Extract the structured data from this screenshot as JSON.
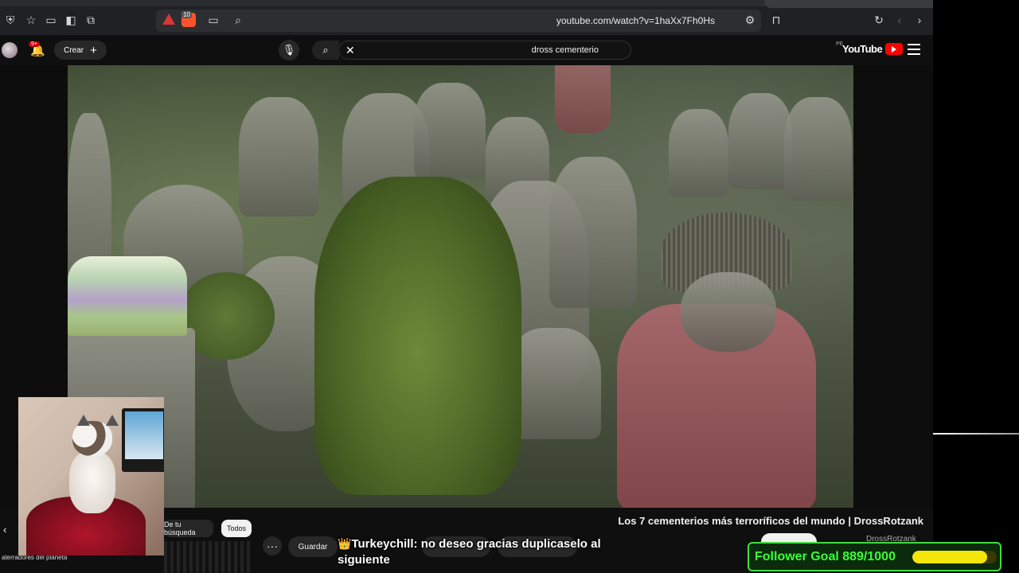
{
  "browser": {
    "url": "youtube.com/watch?v=1haXx7Fh0Hs",
    "brave_badge": "10"
  },
  "youtube": {
    "logo_text": "YouTube",
    "country_code": "PE",
    "search_query": "dross cementerio",
    "create_label": "Crear",
    "notifications_badge": "9+"
  },
  "video": {
    "title": "Los 7 cementerios más terroríficos del mundo | DrossRotzank",
    "channel": "DrossRotzank",
    "save_label": "Guardar",
    "more_label": "···"
  },
  "chips": {
    "prev": "‹",
    "todos": "Todos",
    "tu_busqueda": "De tu búsqueda"
  },
  "recommendation": {
    "title": "aterradores del planeta"
  },
  "chat": {
    "crown": "👑",
    "username": "Turkeychill",
    "message": ": no deseo gracias duplicaselo al siguiente"
  },
  "follower_goal": {
    "label": "Follower Goal 889/1000",
    "current": 889,
    "target": 1000,
    "fill_color": "#f5e60a",
    "text_color": "#39ff39"
  },
  "colors": {
    "yt_red": "#ff0000",
    "background": "#0f0f0f"
  },
  "icons": [
    "shield-icon",
    "star-icon",
    "window-icon",
    "sidebar-icon",
    "copy-icon",
    "warning-icon",
    "brave-icon",
    "cast-icon",
    "zoom-icon",
    "settings-icon",
    "bookmark-icon",
    "reload-icon",
    "back-icon",
    "forward-icon",
    "menu-icon",
    "mic-icon",
    "search-icon",
    "close-icon",
    "bell-icon",
    "plus-icon"
  ]
}
